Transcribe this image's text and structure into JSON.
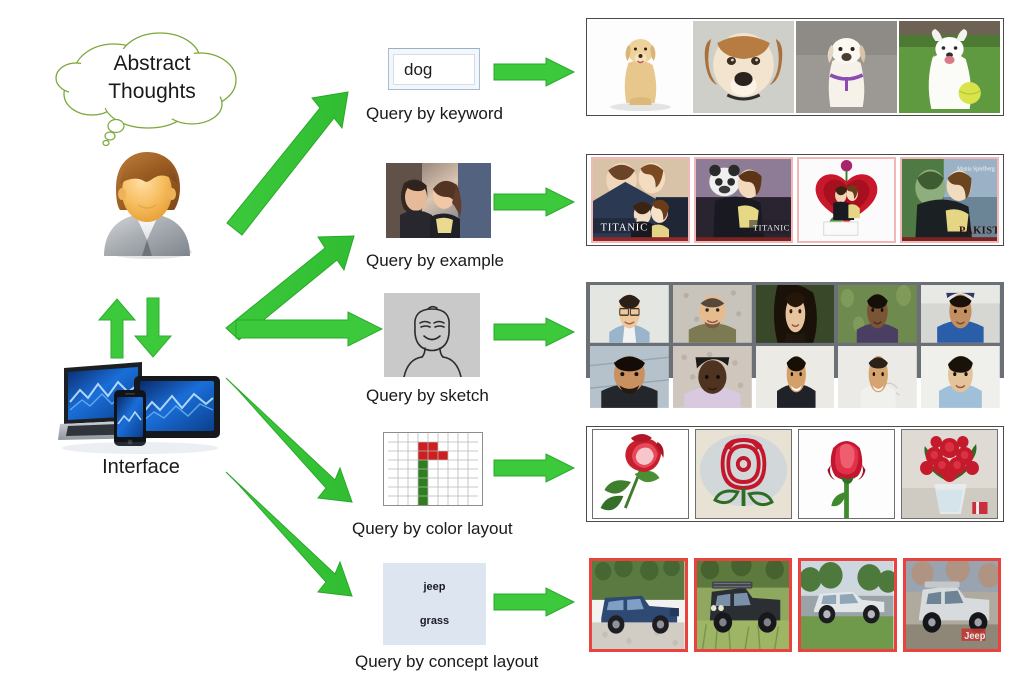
{
  "figure": {
    "title": "Image retrieval query modalities diagram",
    "accent_green": "#3cc93c",
    "cloud_stroke": "#6fa32f",
    "background": "#ffffff"
  },
  "left_panel": {
    "thought_bubble": {
      "name": "abstract-thoughts-cloud",
      "line1": "Abstract",
      "line2": "Thoughts"
    },
    "avatar": {
      "name": "user-avatar",
      "label": ""
    },
    "devices": {
      "name": "device-cluster",
      "items": [
        "laptop",
        "tablet",
        "smartphone"
      ]
    },
    "interface_label": "Interface",
    "exchange_arrows": {
      "up": "arrow-up",
      "down": "arrow-down"
    }
  },
  "queries": [
    {
      "id": "keyword",
      "label": "Query by keyword",
      "input_value": "dog",
      "input_placeholder": "dog",
      "widget": "text-input"
    },
    {
      "id": "example",
      "label": "Query by example",
      "widget": "example-image",
      "image_caption": "Titanic couple kissing still"
    },
    {
      "id": "sketch",
      "label": "Query by sketch",
      "widget": "sketch-canvas",
      "image_caption": "Hand drawn smiling face sketch"
    },
    {
      "id": "color-layout",
      "label": "Query by color layout",
      "widget": "color-grid",
      "grid": {
        "cols": 9,
        "rows": 8,
        "red": "#cc1f1f",
        "green": "#2e7d1f"
      }
    },
    {
      "id": "concept-layout",
      "label": "Query by concept layout",
      "widget": "concept-canvas",
      "tokens": [
        "jeep",
        "grass"
      ]
    }
  ],
  "results": [
    {
      "id": "dogs",
      "query_id": "keyword",
      "border_style": "thin-dark",
      "items": [
        {
          "caption": "golden retriever sitting on white"
        },
        {
          "caption": "beagle close-up portrait"
        },
        {
          "caption": "white puppy with purple harness"
        },
        {
          "caption": "white spitz on grass with tennis ball"
        }
      ]
    },
    {
      "id": "posters",
      "query_id": "example",
      "border_style": "pink-frames",
      "items": [
        {
          "caption": "TITANIC movie poster"
        },
        {
          "caption": "Titanic poster variant with panda overlay"
        },
        {
          "caption": "red heart with rose and couple"
        },
        {
          "caption": "PAKISTAN poster with couple"
        }
      ]
    },
    {
      "id": "faces",
      "query_id": "sketch",
      "border_style": "gray-panel",
      "rows": [
        [
          {
            "caption": "man with glasses, plaid shirt"
          },
          {
            "caption": "bald man with backpack"
          },
          {
            "caption": "woman with long dark hair"
          },
          {
            "caption": "boy in purple shirt outdoors"
          },
          {
            "caption": "young man in cap and blue tee"
          }
        ],
        [
          {
            "caption": "man with beard in black tee"
          },
          {
            "caption": "man in cap and lavender shirt"
          },
          {
            "caption": "smiling man in dark shirt"
          },
          {
            "caption": "man in white tee on whiteboard"
          },
          {
            "caption": "man in light blue shirt"
          }
        ]
      ]
    },
    {
      "id": "roses",
      "query_id": "color-layout",
      "border_style": "thin-gray",
      "items": [
        {
          "caption": "red rose with leaves on white"
        },
        {
          "caption": "stylized rose emblem"
        },
        {
          "caption": "single rose bud on stem"
        },
        {
          "caption": "bouquet of red roses in vase"
        }
      ]
    },
    {
      "id": "jeeps",
      "query_id": "concept-layout",
      "border_style": "red-frames",
      "items": [
        {
          "caption": "blue jeep on gravel"
        },
        {
          "caption": "black jeep in tall grass"
        },
        {
          "caption": "silver SUV on road"
        },
        {
          "caption": "silver jeep with Jeep logo"
        }
      ]
    }
  ]
}
